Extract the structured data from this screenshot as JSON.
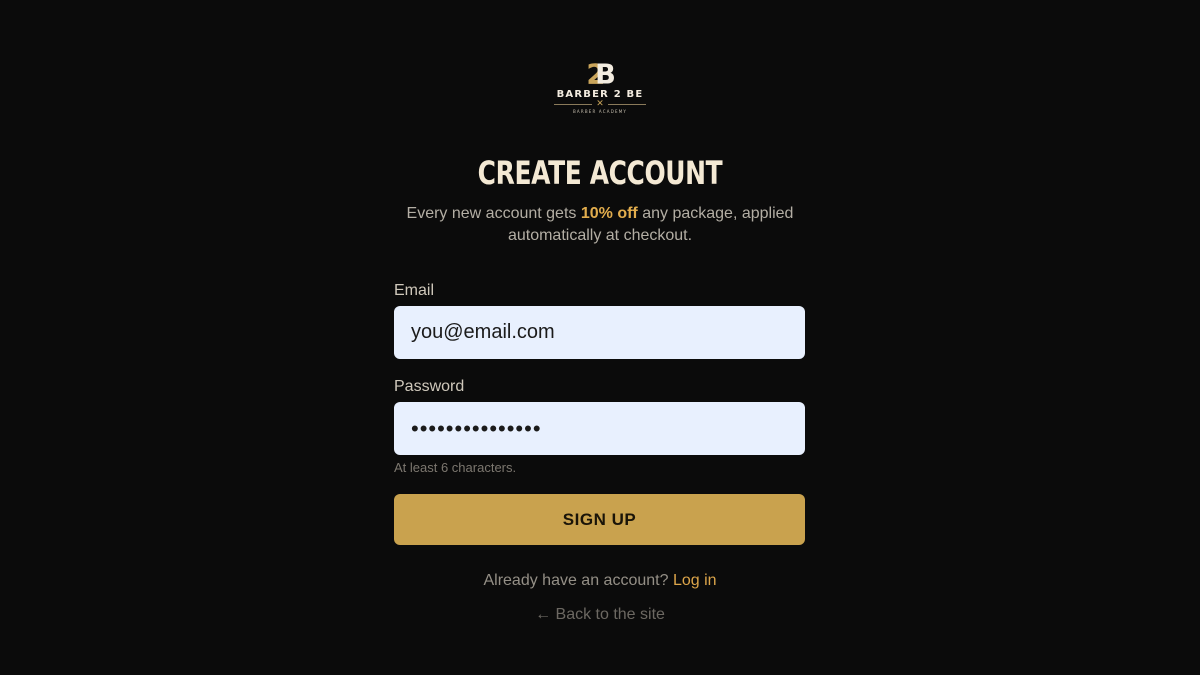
{
  "brand": {
    "mark_text": "2B",
    "name": "BARBER 2 BE",
    "tagline": "BARBER ACADEMY",
    "colors": {
      "gold": "#c9a24e",
      "accent": "#e2ad4d",
      "background": "#0b0b0b"
    }
  },
  "header": {
    "title": "CREATE ACCOUNT",
    "subtitle_before": "Every new account gets",
    "subtitle_highlight": "10% off",
    "subtitle_after": "any package, applied automatically at checkout."
  },
  "form": {
    "email": {
      "label": "Email",
      "value": "you@email.com"
    },
    "password": {
      "label": "Password",
      "masked_value": "•••••••••••••••",
      "hint": "At least 6 characters."
    },
    "submit_label": "SIGN UP"
  },
  "footer": {
    "login_prompt": "Already have an account?",
    "login_link": "Log in",
    "back_link": "← Back to the site"
  }
}
